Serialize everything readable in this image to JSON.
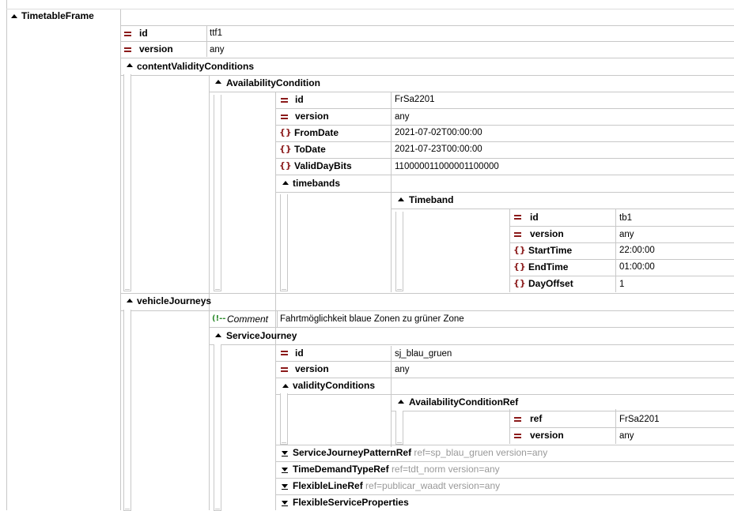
{
  "root": {
    "label": "TimetableFrame"
  },
  "frame_attrs": [
    {
      "name": "id",
      "value": "ttf1"
    },
    {
      "name": "version",
      "value": "any"
    }
  ],
  "content_validity": {
    "label": "contentValidityConditions",
    "availability": {
      "label": "AvailabilityCondition",
      "attrs": [
        {
          "name": "id",
          "value": "FrSa2201"
        },
        {
          "name": "version",
          "value": "any"
        }
      ],
      "elements": [
        {
          "name": "FromDate",
          "value": "2021-07-02T00:00:00"
        },
        {
          "name": "ToDate",
          "value": "2021-07-23T00:00:00"
        },
        {
          "name": "ValidDayBits",
          "value": "110000011000001100000"
        }
      ],
      "timebands": {
        "label": "timebands",
        "timeband": {
          "label": "Timeband",
          "attrs": [
            {
              "name": "id",
              "value": "tb1"
            },
            {
              "name": "version",
              "value": "any"
            }
          ],
          "elements": [
            {
              "name": "StartTime",
              "value": "22:00:00"
            },
            {
              "name": "EndTime",
              "value": "01:00:00"
            },
            {
              "name": "DayOffset",
              "value": "1"
            }
          ]
        }
      }
    }
  },
  "vehicle_journeys": {
    "label": "vehicleJourneys",
    "comment": {
      "label": "Comment",
      "text": "Fahrtmöglichkeit blaue Zonen zu grüner Zone"
    },
    "service_journey": {
      "label": "ServiceJourney",
      "attrs": [
        {
          "name": "id",
          "value": "sj_blau_gruen"
        },
        {
          "name": "version",
          "value": "any"
        }
      ],
      "validity": {
        "label": "validityConditions",
        "ref_label": "AvailabilityConditionRef",
        "attrs": [
          {
            "name": "ref",
            "value": "FrSa2201"
          },
          {
            "name": "version",
            "value": "any"
          }
        ]
      },
      "collapsed": [
        {
          "name": "ServiceJourneyPatternRef",
          "attrs": "ref=sp_blau_gruen version=any"
        },
        {
          "name": "TimeDemandTypeRef",
          "attrs": "ref=tdt_norm version=any"
        },
        {
          "name": "FlexibleLineRef",
          "attrs": "ref=publicar_waadt version=any"
        },
        {
          "name": "FlexibleServiceProperties",
          "attrs": ""
        }
      ]
    }
  }
}
